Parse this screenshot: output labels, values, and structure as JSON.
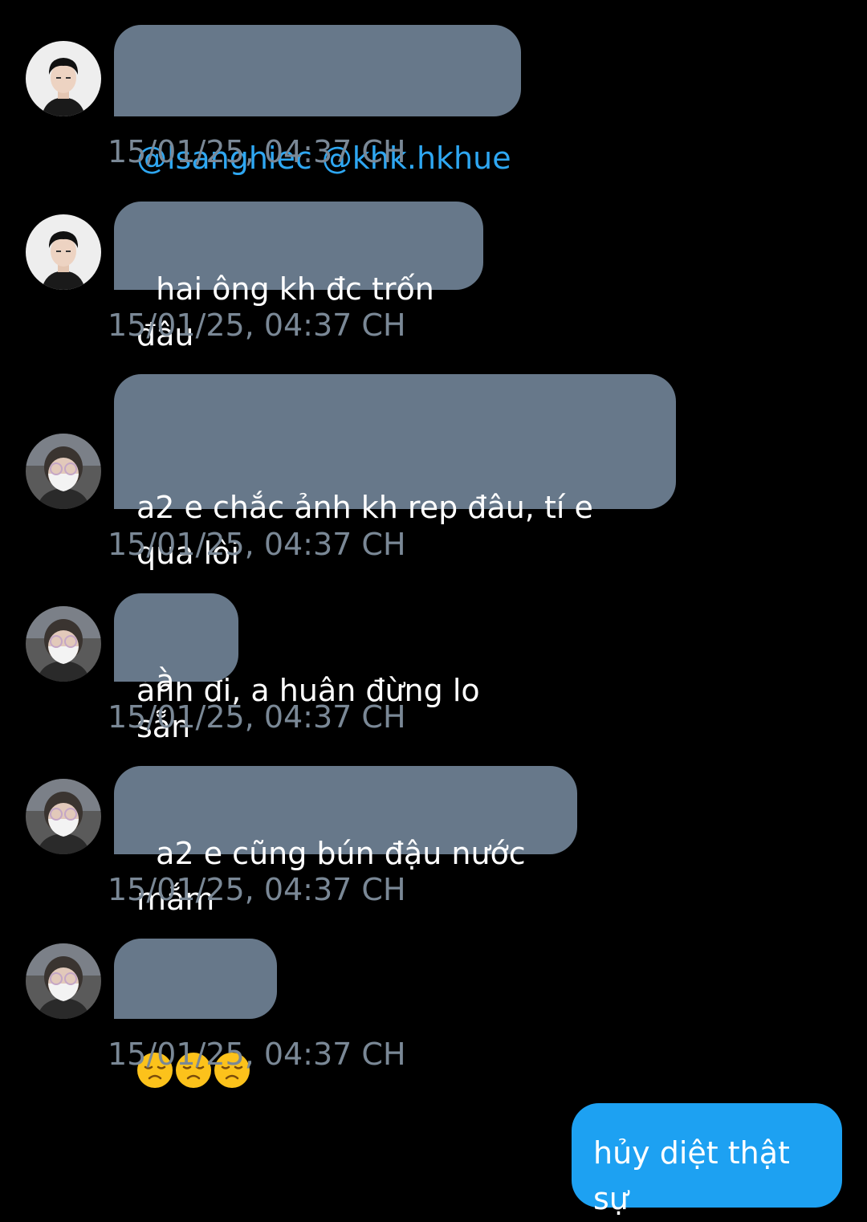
{
  "messages": [
    {
      "mentions": [
        "@lsanghiec",
        "@khk.hkhue"
      ],
      "timestamp": "15/01/25, 04:37 CH"
    },
    {
      "text": "hai ông kh đc trốn đâu",
      "timestamp": "15/01/25, 04:37 CH"
    },
    {
      "lines": [
        "a2 e chắc ảnh kh rep đâu, tí e qua lôi",
        "ảnh đi, a huân đừng lo"
      ],
      "timestamp": "15/01/25, 04:37 CH"
    },
    {
      "text": "à sẵn",
      "timestamp": "15/01/25, 04:37 CH"
    },
    {
      "text": "a2 e cũng bún đậu nước mắm",
      "timestamp": "15/01/25, 04:37 CH"
    },
    {
      "emojis": [
        "disappointed-face-icon",
        "disappointed-face-icon",
        "disappointed-face-icon"
      ],
      "timestamp": "15/01/25, 04:37 CH"
    }
  ],
  "outgoing": {
    "text": "hủy diệt thật sự"
  },
  "colors": {
    "background": "#000000",
    "incoming_bubble": "#67788a",
    "outgoing_bubble": "#1da1f2",
    "mention": "#2ea7f2",
    "timestamp": "#7a8896"
  }
}
